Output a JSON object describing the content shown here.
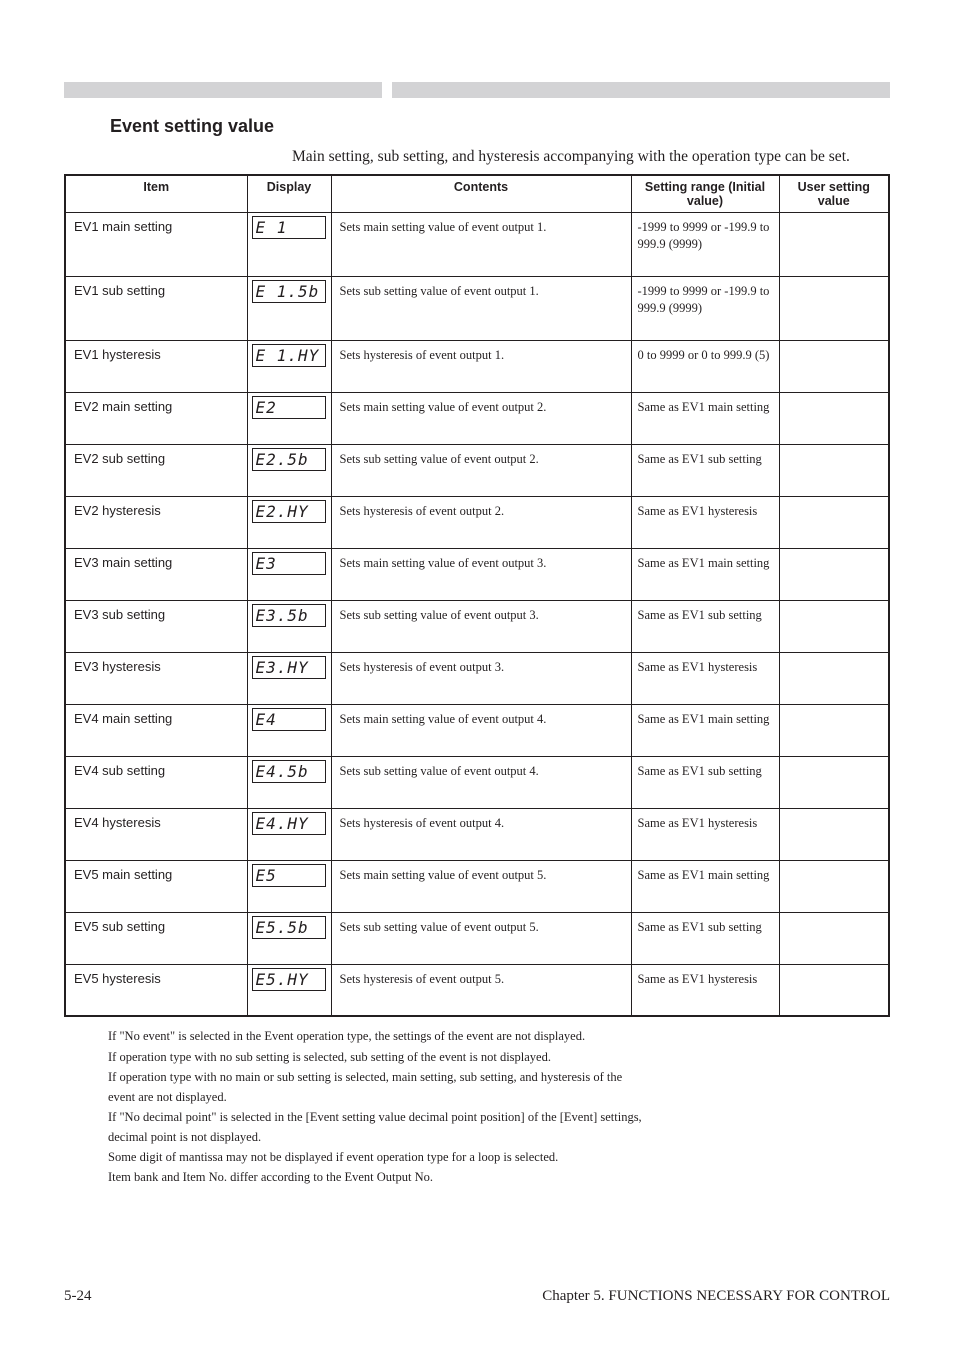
{
  "section_title": "Event setting value",
  "intro": "Main setting, sub setting, and hysteresis accompanying with the operation type can be set.",
  "table": {
    "headers": [
      "Item",
      "Display",
      "Contents",
      "Setting range (Initial value)",
      "User setting value"
    ],
    "rows": [
      {
        "name": "EV1 main setting",
        "disp": "E 1",
        "contents": "Sets main setting value of event output 1.",
        "range": "-1999 to 9999 or -199.9 to 999.9 (9999)",
        "cls": "tall-1"
      },
      {
        "name": "EV1 sub setting",
        "disp": "E 1.5b",
        "contents": "Sets sub setting value of event output 1.",
        "range": "-1999 to 9999 or -199.9 to 999.9 (9999)",
        "cls": "tall-1"
      },
      {
        "name": "EV1 hysteresis",
        "disp": "E 1.HY",
        "contents": "Sets hysteresis of event output 1.",
        "range": "0 to 9999 or 0 to 999.9 (5)",
        "cls": "tall-3"
      },
      {
        "name": "EV2 main setting",
        "disp": "E2",
        "contents": "Sets main setting value of event output 2.",
        "range": "Same as EV1 main setting",
        "cls": "tall-3"
      },
      {
        "name": "EV2 sub setting",
        "disp": "E2.5b",
        "contents": "Sets sub setting value of event output 2.",
        "range": "Same as EV1 sub setting",
        "cls": "tall-3"
      },
      {
        "name": "EV2 hysteresis",
        "disp": "E2.HY",
        "contents": "Sets hysteresis of event output 2.",
        "range": "Same as EV1 hysteresis",
        "cls": "tall-3"
      },
      {
        "name": "EV3 main setting",
        "disp": "E3",
        "contents": "Sets main setting value of event output 3.",
        "range": "Same as EV1 main setting",
        "cls": "tall-3"
      },
      {
        "name": "EV3 sub setting",
        "disp": "E3.5b",
        "contents": "Sets sub setting value of event output 3.",
        "range": "Same as EV1 sub setting",
        "cls": "tall-3"
      },
      {
        "name": "EV3 hysteresis",
        "disp": "E3.HY",
        "contents": "Sets hysteresis of event output 3.",
        "range": "Same as EV1 hysteresis",
        "cls": "tall-3"
      },
      {
        "name": "EV4 main setting",
        "disp": "E4",
        "contents": "Sets main setting value of event output 4.",
        "range": "Same as EV1 main setting",
        "cls": "tall-3"
      },
      {
        "name": "EV4 sub setting",
        "disp": "E4.5b",
        "contents": "Sets sub setting value of event output 4.",
        "range": "Same as EV1 sub setting",
        "cls": "tall-3"
      },
      {
        "name": "EV4 hysteresis",
        "disp": "E4.HY",
        "contents": "Sets hysteresis of event output 4.",
        "range": "Same as EV1 hysteresis",
        "cls": "tall-3"
      },
      {
        "name": "EV5 main setting",
        "disp": "E5",
        "contents": "Sets main setting value of event output 5.",
        "range": "Same as EV1 main setting",
        "cls": "tall-3"
      },
      {
        "name": "EV5 sub setting",
        "disp": "E5.5b",
        "contents": "Sets sub setting value of event output 5.",
        "range": "Same as EV1 sub setting",
        "cls": "tall-3"
      },
      {
        "name": "EV5 hysteresis",
        "disp": "E5.HY",
        "contents": "Sets hysteresis of event output 5.",
        "range": "Same as EV1 hysteresis",
        "cls": "tall-3"
      }
    ]
  },
  "notes": [
    "If \"No event\" is selected in the Event operation type, the settings of the event are not displayed.",
    "If operation type with no sub setting is selected, sub setting of the event is not displayed.",
    "If operation type with no main or sub setting is selected, main setting, sub setting, and hysteresis of the",
    "event are not displayed.",
    "If \"No decimal point\" is selected in the [Event setting value decimal point position] of the [Event] settings,",
    "decimal point is not displayed.",
    "Some digit of mantissa may not be displayed if event operation type for a loop is selected.",
    "Item bank and Item No. differ according to the Event Output No."
  ],
  "footer": {
    "left": "5-24",
    "right": "Chapter 5.  FUNCTIONS NECESSARY FOR CONTROL"
  }
}
